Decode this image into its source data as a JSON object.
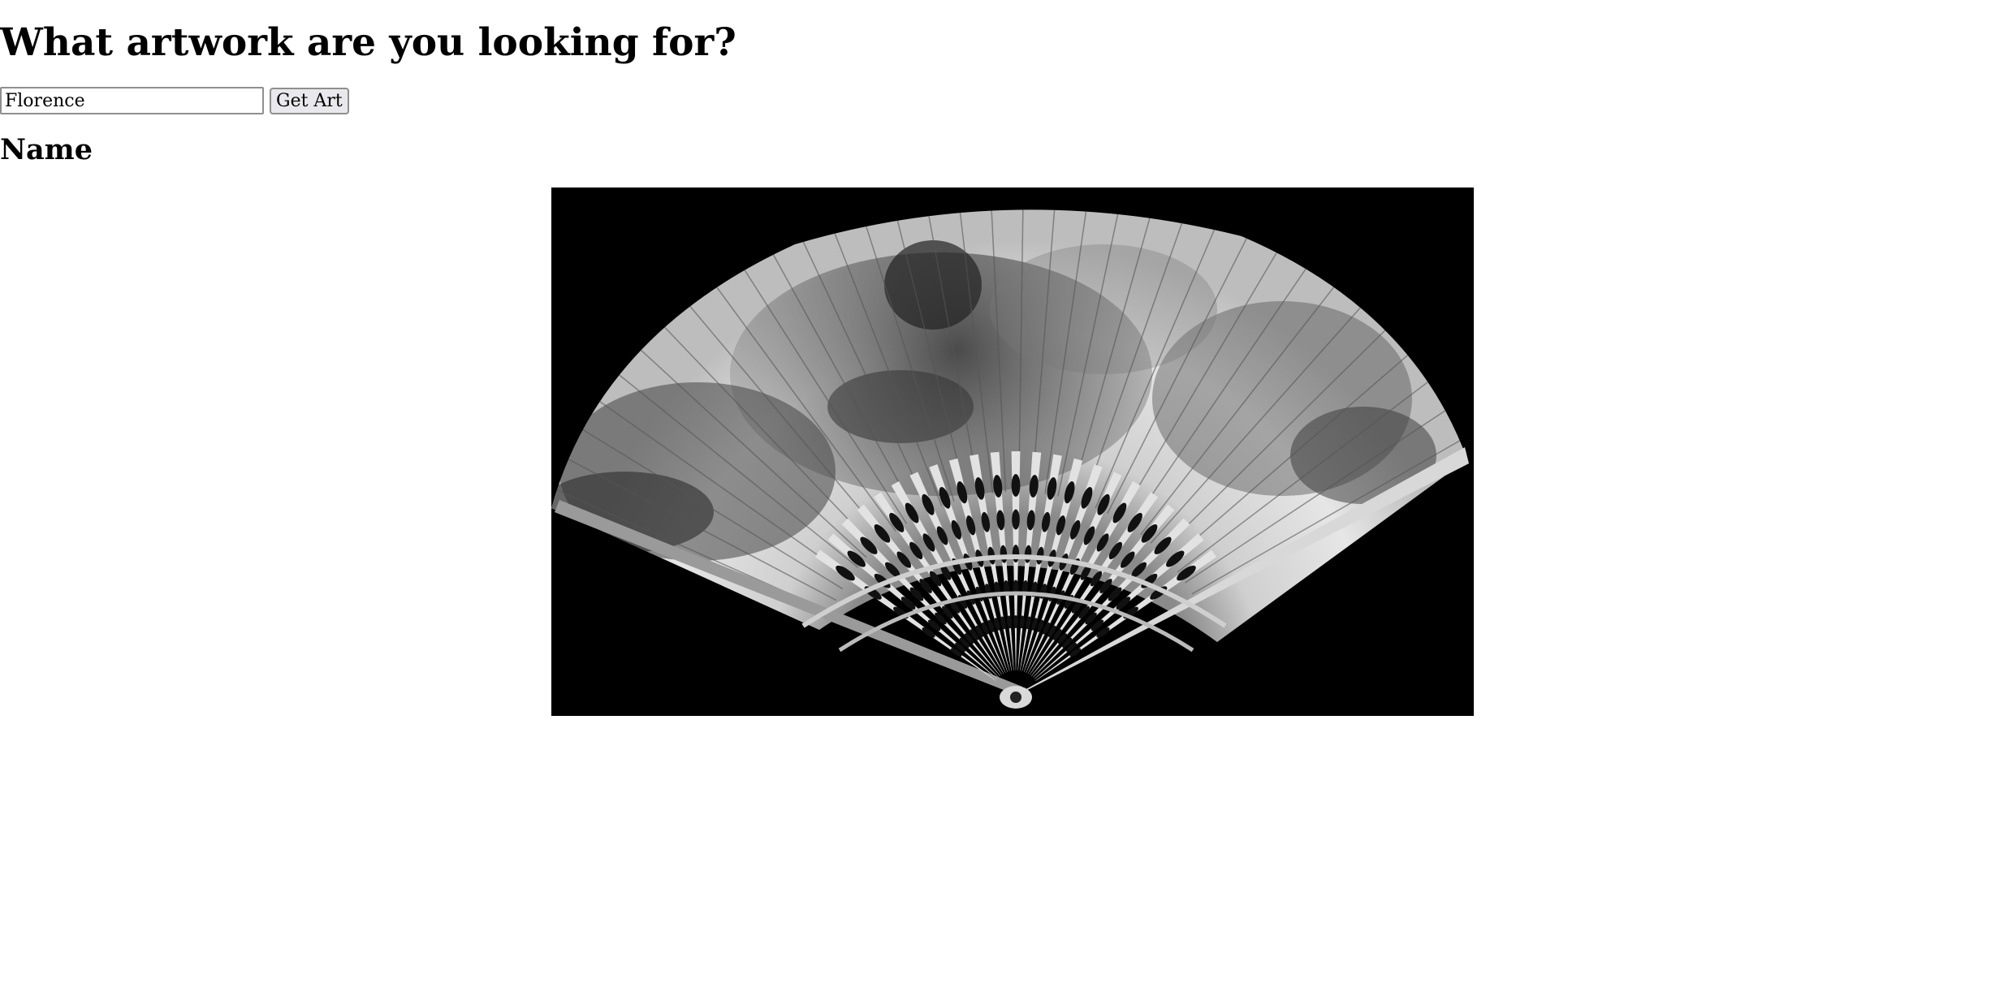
{
  "page": {
    "heading": "What artwork are you looking for?",
    "search": {
      "value": "Florence",
      "button_label": "Get Art"
    },
    "result": {
      "name_label": "Name",
      "image": {
        "subject": "black and white photograph of an open folding fan with painted mythological scene and pierced ivory sticks",
        "background_color": "#000000"
      }
    }
  }
}
